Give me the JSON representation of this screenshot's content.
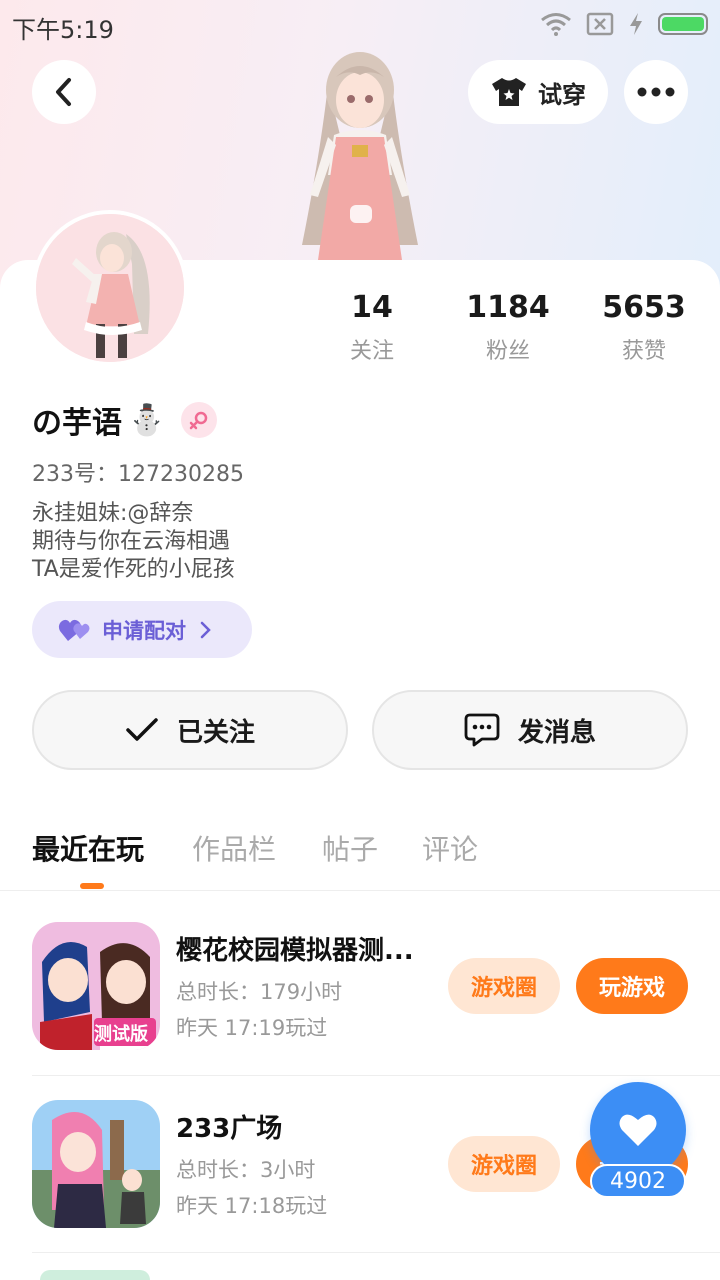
{
  "status_bar": {
    "time": "下午5:19"
  },
  "header": {
    "tryon_label": "试穿"
  },
  "stats": [
    {
      "value": "14",
      "label": "关注"
    },
    {
      "value": "1184",
      "label": "粉丝"
    },
    {
      "value": "5653",
      "label": "获赞"
    }
  ],
  "profile": {
    "username": "の芋语",
    "username_emoji": "⛄",
    "uid": "233号：127230285",
    "bio": [
      "永挂姐妹:@辞奈",
      "期待与你在云海相遇",
      "TA是爱作死的小屁孩"
    ],
    "match_label": "申请配对"
  },
  "actions": {
    "follow_label": "已关注",
    "message_label": "发消息"
  },
  "tabs": [
    {
      "label": "最近在玩",
      "active": true
    },
    {
      "label": "作品栏",
      "active": false
    },
    {
      "label": "帖子",
      "active": false
    },
    {
      "label": "评论",
      "active": false
    }
  ],
  "games": [
    {
      "title": "樱花校园模拟器测...",
      "duration": "总时长：179小时",
      "last_played": "昨天 17:19玩过",
      "circle_label": "游戏圈",
      "play_label": "玩游戏",
      "icon_badge": "测试版"
    },
    {
      "title": "233广场",
      "duration": "总时长：3小时",
      "last_played": "昨天 17:18玩过",
      "circle_label": "游戏圈",
      "play_label": "玩游戏"
    }
  ],
  "like_fab": {
    "count": "4902"
  },
  "colors": {
    "accent": "#ff7a1a",
    "like_blue": "#3c8ef5",
    "match_purple": "#6b5fd6"
  }
}
